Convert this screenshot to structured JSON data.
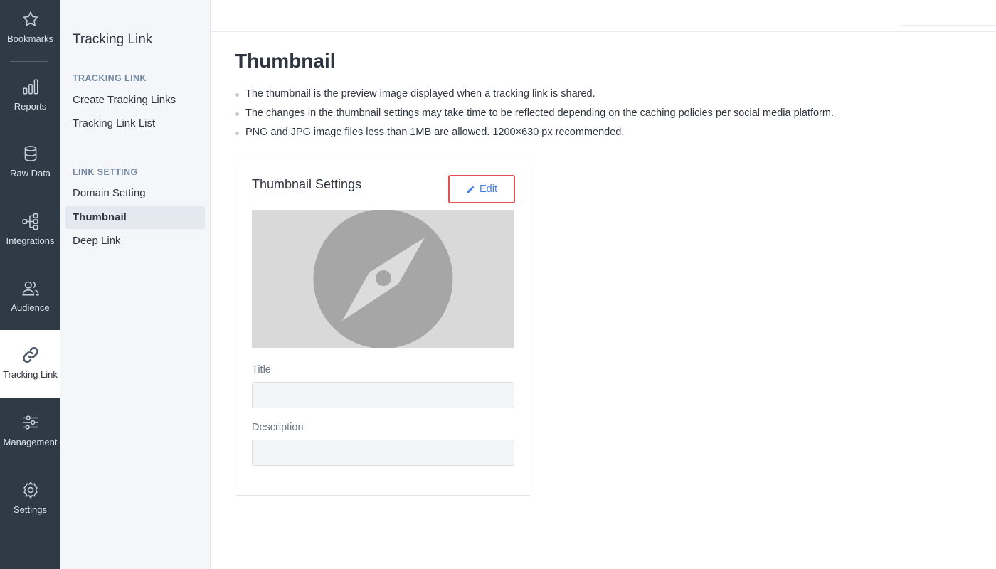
{
  "rail": {
    "items": [
      {
        "label": "Bookmarks",
        "icon": "star-icon"
      },
      {
        "label": "Reports",
        "icon": "bar-chart-icon"
      },
      {
        "label": "Raw Data",
        "icon": "database-icon"
      },
      {
        "label": "Integrations",
        "icon": "integrations-icon"
      },
      {
        "label": "Audience",
        "icon": "users-icon"
      },
      {
        "label": "Tracking Link",
        "icon": "link-icon",
        "active": true
      },
      {
        "label": "Management",
        "icon": "sliders-icon"
      },
      {
        "label": "Settings",
        "icon": "gear-icon"
      }
    ]
  },
  "subnav": {
    "title": "Tracking Link",
    "sections": [
      {
        "heading": "TRACKING LINK",
        "items": [
          "Create Tracking Links",
          "Tracking Link List"
        ]
      },
      {
        "heading": "LINK SETTING",
        "items": [
          "Domain Setting",
          "Thumbnail",
          "Deep Link"
        ]
      }
    ],
    "active_item": "Thumbnail"
  },
  "page": {
    "title": "Thumbnail",
    "notes": [
      "The thumbnail is the preview image displayed when a tracking link is shared.",
      "The changes in the thumbnail settings may take time to be reflected depending on the caching policies per social media platform.",
      "PNG and JPG image files less than 1MB are allowed. 1200×630 px recommended."
    ]
  },
  "card": {
    "title": "Thumbnail Settings",
    "edit_label": "Edit",
    "title_label": "Title",
    "title_value": "",
    "description_label": "Description",
    "description_value": "",
    "placeholder_icon": "compass-icon"
  },
  "colors": {
    "rail_bg": "#2f3a47",
    "accent": "#3f82e8",
    "highlight_border": "#e2504f"
  }
}
